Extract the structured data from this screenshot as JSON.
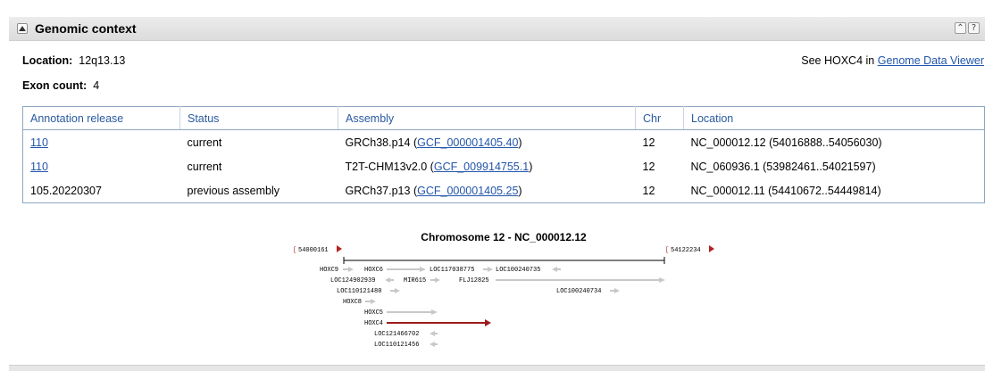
{
  "section": {
    "title": "Genomic context",
    "up_button": "⌃",
    "help_button": "?"
  },
  "info": {
    "location_label": "Location:",
    "location_value": "12q13.13",
    "exon_label": "Exon count:",
    "exon_value": "4",
    "see_prefix": "See HOXC4 in ",
    "see_link": "Genome Data Viewer"
  },
  "table": {
    "headers": [
      "Annotation release",
      "Status",
      "Assembly",
      "Chr",
      "Location"
    ],
    "rows": [
      {
        "release": "110",
        "release_link": true,
        "status": "current",
        "assembly_name": "GRCh38.p14",
        "assembly_acc": "GCF_000001405.40",
        "chr": "12",
        "location": "NC_000012.12 (54016888..54056030)"
      },
      {
        "release": "110",
        "release_link": true,
        "status": "current",
        "assembly_name": "T2T-CHM13v2.0",
        "assembly_acc": "GCF_009914755.1",
        "chr": "12",
        "location": "NC_060936.1 (53982461..54021597)"
      },
      {
        "release": "105.20220307",
        "release_link": false,
        "status": "previous assembly",
        "assembly_name": "GRCh37.p13",
        "assembly_acc": "GCF_000001405.25",
        "chr": "12",
        "location": "NC_000012.11 (54410672..54449814)"
      }
    ]
  },
  "graphic": {
    "title": "Chromosome 12 - NC_000012.12",
    "left_coord": "54000161",
    "right_coord": "54122234",
    "genes": {
      "HOXC9": "HOXC9",
      "HOXC6": "HOXC6",
      "LOC117038775": "LOC117038775",
      "LOC100240735": "LOC100240735",
      "LOC124902939": "LOC124902939",
      "MIR615": "MIR615",
      "FLJ12825": "FLJ12825",
      "LOC110121480": "LOC110121480",
      "LOC100240734": "LOC100240734",
      "HOXC8": "HOXC8",
      "HOXC5": "HOXC5",
      "HOXC4": "HOXC4",
      "LOC121466702": "LOC121466702",
      "LOC110121456": "LOC110121456"
    },
    "colors": {
      "gene": "#c8c8c8",
      "highlight": "#9b1c1c",
      "bracket": "#b22222"
    }
  }
}
